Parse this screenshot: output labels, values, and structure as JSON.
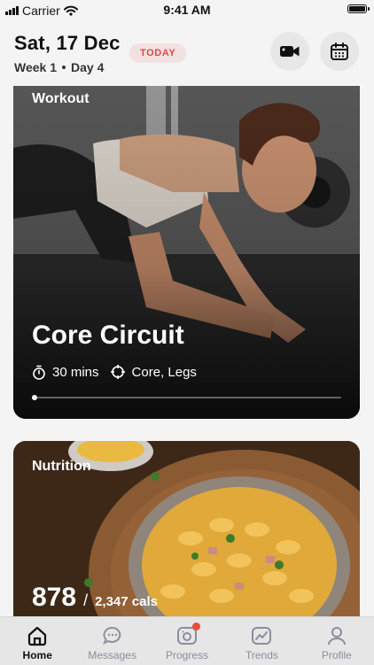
{
  "status_bar": {
    "carrier": "Carrier",
    "time": "9:41 AM"
  },
  "header": {
    "date": "Sat, 17 Dec",
    "today_badge": "TODAY",
    "week": "Week 1",
    "day": "Day 4",
    "buttons": {
      "video_icon": "video-camera-icon",
      "calendar_icon": "calendar-icon"
    }
  },
  "workout_card": {
    "label": "Workout",
    "title": "Core Circuit",
    "duration": "30 mins",
    "focus": "Core, Legs",
    "progress": 0.0
  },
  "nutrition_card": {
    "label": "Nutrition",
    "calories_eaten": "878",
    "calories_target": "2,347 cals"
  },
  "tabbar": {
    "items": [
      {
        "label": "Home",
        "icon": "home-icon",
        "active": true
      },
      {
        "label": "Messages",
        "icon": "messages-icon"
      },
      {
        "label": "Progress",
        "icon": "progress-camera-icon",
        "badge": true
      },
      {
        "label": "Trends",
        "icon": "trends-icon"
      },
      {
        "label": "Profile",
        "icon": "profile-icon"
      }
    ]
  },
  "colors": {
    "accent": "#e04747",
    "badge": "#e94c3b",
    "tabbar_bg": "#e6e6e6"
  }
}
